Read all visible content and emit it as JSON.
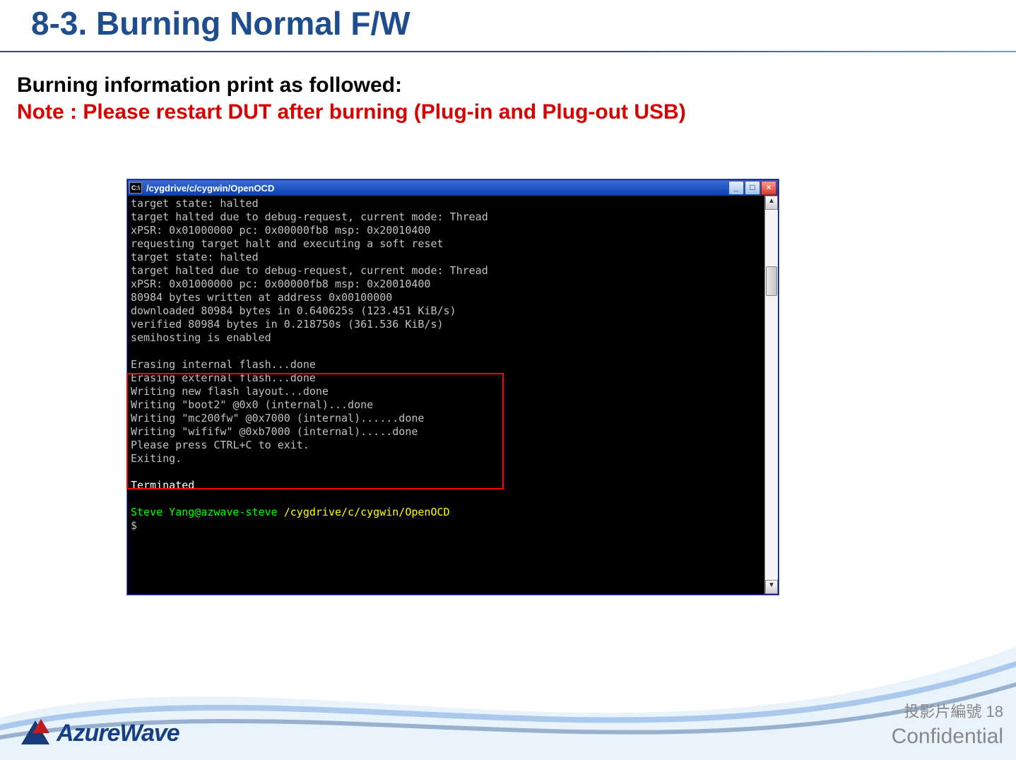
{
  "slide": {
    "title": "8-3. Burning Normal F/W",
    "body_line": "Burning information print as followed:",
    "note_line": "Note : Please restart DUT after burning (Plug-in and Plug-out USB)"
  },
  "console": {
    "icon_label": "C:\\",
    "title": "/cygdrive/c/cygwin/OpenOCD",
    "buttons": {
      "min": "_",
      "max": "□",
      "close": "×"
    },
    "scroll": {
      "up": "▲",
      "down": "▼"
    },
    "lines_pre": "target state: halted\ntarget halted due to debug-request, current mode: Thread\nxPSR: 0x01000000 pc: 0x00000fb8 msp: 0x20010400\nrequesting target halt and executing a soft reset\ntarget state: halted\ntarget halted due to debug-request, current mode: Thread\nxPSR: 0x01000000 pc: 0x00000fb8 msp: 0x20010400\n80984 bytes written at address 0x00100000\ndownloaded 80984 bytes in 0.640625s (123.451 KiB/s)\nverified 80984 bytes in 0.218750s (361.536 KiB/s)\nsemihosting is enabled\n",
    "lines_hl": "Erasing internal flash...done\nErasing external flash...done\nWriting new flash layout...done\nWriting \"boot2\" @0x0 (internal)...done\nWriting \"mc200fw\" @0x7000 (internal)......done\nWriting \"wififw\" @0xb7000 (internal).....done\nPlease press CTRL+C to exit.\nExiting.",
    "line_term": "Terminated",
    "prompt_user": "Steve Yang@azwave-steve ",
    "prompt_path": "/cygdrive/c/cygwin/OpenOCD",
    "prompt_dollar": "$"
  },
  "footer": {
    "logo_text": "AzureWave",
    "slide_number_label": "投影片編號 18",
    "confidential": "Confidential"
  }
}
